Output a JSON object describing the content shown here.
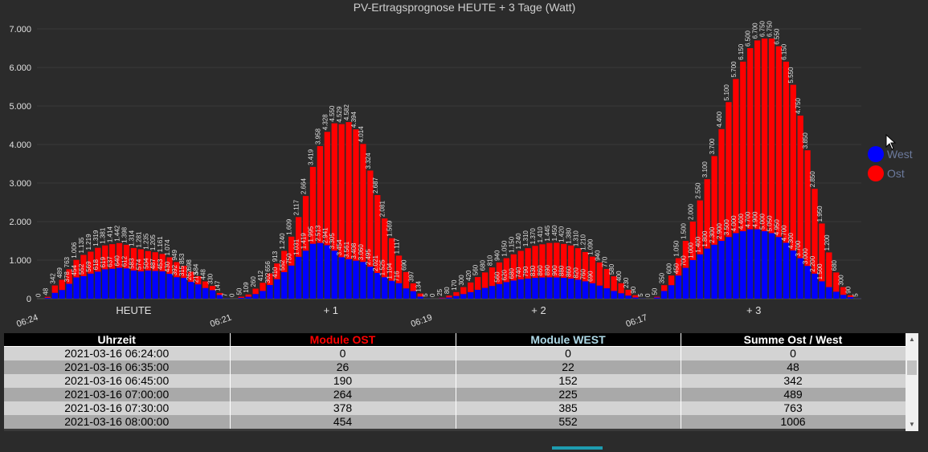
{
  "chart_data": {
    "type": "bar",
    "title": "PV-Ertragsprognose HEUTE + 3 Tage (Watt)",
    "ylim": [
      0,
      7000
    ],
    "yticks": [
      "0",
      "1.000",
      "2.000",
      "3.000",
      "4.000",
      "5.000",
      "6.000",
      "7.000"
    ],
    "grid": true,
    "legend_position": "right",
    "series": [
      {
        "name": "West",
        "color": "#0000ff"
      },
      {
        "name": "Ost",
        "color": "#ff0000"
      }
    ],
    "days": [
      {
        "label": "HEUTE",
        "start_time": "06:24",
        "ost": [
          0,
          26,
          190,
          264,
          378,
          454,
          552,
          569,
          618,
          619,
          637,
          640,
          612,
          583,
          574,
          504,
          487,
          453,
          430,
          392,
          315,
          262,
          213,
          171,
          110,
          52,
          0
        ],
        "west": [
          0,
          22,
          152,
          225,
          385,
          552,
          583,
          650,
          701,
          762,
          777,
          802,
          786,
          731,
          707,
          731,
          718,
          708,
          644,
          557,
          538,
          436,
          371,
          277,
          220,
          95,
          7
        ],
        "total": [
          0,
          48,
          342,
          489,
          763,
          1006,
          1135,
          1219,
          1319,
          1381,
          1414,
          1442,
          1398,
          1314,
          1281,
          1235,
          1205,
          1161,
          1074,
          949,
          853,
          698,
          584,
          448,
          330,
          147,
          7
        ]
      },
      {
        "label": "+ 1",
        "start_time": "06:21",
        "ost": [
          0,
          29,
          59,
          140,
          212,
          302,
          410,
          552,
          750,
          1031,
          1419,
          1995,
          2513,
          2941,
          3305,
          3454,
          3561,
          3408,
          3060,
          2495,
          2021,
          1525,
          1104,
          716,
          423,
          201,
          80,
          0
        ],
        "west": [
          0,
          21,
          50,
          120,
          200,
          354,
          503,
          688,
          859,
          1086,
          1245,
          1424,
          1445,
          1387,
          1245,
          1075,
          1021,
          986,
          954,
          829,
          666,
          556,
          465,
          401,
          267,
          196,
          54,
          5
        ],
        "total": [
          0,
          50,
          109,
          260,
          412,
          656,
          913,
          1240,
          1609,
          2117,
          2664,
          3419,
          3958,
          4328,
          4550,
          4529,
          4582,
          4394,
          4014,
          3324,
          2687,
          2081,
          1569,
          1117,
          690,
          397,
          134,
          5
        ]
      },
      {
        "label": "+ 2",
        "start_time": "06:19",
        "ost": [
          0,
          15,
          50,
          100,
          180,
          250,
          330,
          400,
          480,
          560,
          620,
          680,
          740,
          790,
          830,
          860,
          890,
          900,
          880,
          860,
          820,
          760,
          690,
          600,
          500,
          380,
          260,
          150,
          60,
          0
        ],
        "west": [
          0,
          10,
          30,
          70,
          120,
          170,
          230,
          280,
          330,
          380,
          430,
          470,
          500,
          520,
          540,
          550,
          555,
          550,
          540,
          520,
          490,
          450,
          400,
          340,
          270,
          200,
          140,
          80,
          30,
          5
        ],
        "total": [
          0,
          25,
          80,
          170,
          300,
          420,
          560,
          680,
          810,
          940,
          1050,
          1150,
          1240,
          1310,
          1370,
          1410,
          1445,
          1450,
          1420,
          1380,
          1310,
          1210,
          1090,
          940,
          770,
          580,
          400,
          230,
          90,
          5
        ]
      },
      {
        "label": "+ 3",
        "start_time": "06:17",
        "ost": [
          0,
          20,
          150,
          250,
          450,
          700,
          1000,
          1400,
          1800,
          2300,
          2900,
          3500,
          4000,
          4400,
          4700,
          4900,
          5000,
          5050,
          4950,
          4700,
          4300,
          3700,
          3000,
          2200,
          1500,
          900,
          500,
          200,
          50,
          0
        ],
        "west": [
          0,
          30,
          200,
          350,
          600,
          800,
          1000,
          1150,
          1300,
          1400,
          1500,
          1600,
          1700,
          1750,
          1800,
          1800,
          1750,
          1700,
          1600,
          1450,
          1250,
          1050,
          850,
          650,
          450,
          300,
          180,
          100,
          40,
          5
        ],
        "total": [
          0,
          50,
          350,
          600,
          1050,
          1500,
          2000,
          2550,
          3100,
          3700,
          4400,
          5100,
          5700,
          6150,
          6500,
          6700,
          6750,
          6750,
          6550,
          6150,
          5550,
          4750,
          3850,
          2850,
          1950,
          1200,
          680,
          300,
          90,
          5
        ]
      }
    ]
  },
  "table": {
    "headers": [
      "Uhrzeit",
      "Module OST",
      "Module WEST",
      "Summe Ost / West"
    ],
    "header_colors": [
      "#ffffff",
      "#ff0000",
      "#add8e6",
      "#ffffff"
    ],
    "rows": [
      [
        "2021-03-16 06:24:00",
        "0",
        "0",
        "0"
      ],
      [
        "2021-03-16 06:35:00",
        "26",
        "22",
        "48"
      ],
      [
        "2021-03-16 06:45:00",
        "190",
        "152",
        "342"
      ],
      [
        "2021-03-16 07:00:00",
        "264",
        "225",
        "489"
      ],
      [
        "2021-03-16 07:30:00",
        "378",
        "385",
        "763"
      ],
      [
        "2021-03-16 08:00:00",
        "454",
        "552",
        "1006"
      ]
    ]
  },
  "scrollbar": {
    "up_icon": "triangle-up",
    "down_icon": "triangle-down"
  },
  "colors": {
    "background": "#2b2b2b",
    "accent": "#1e9cb0"
  }
}
